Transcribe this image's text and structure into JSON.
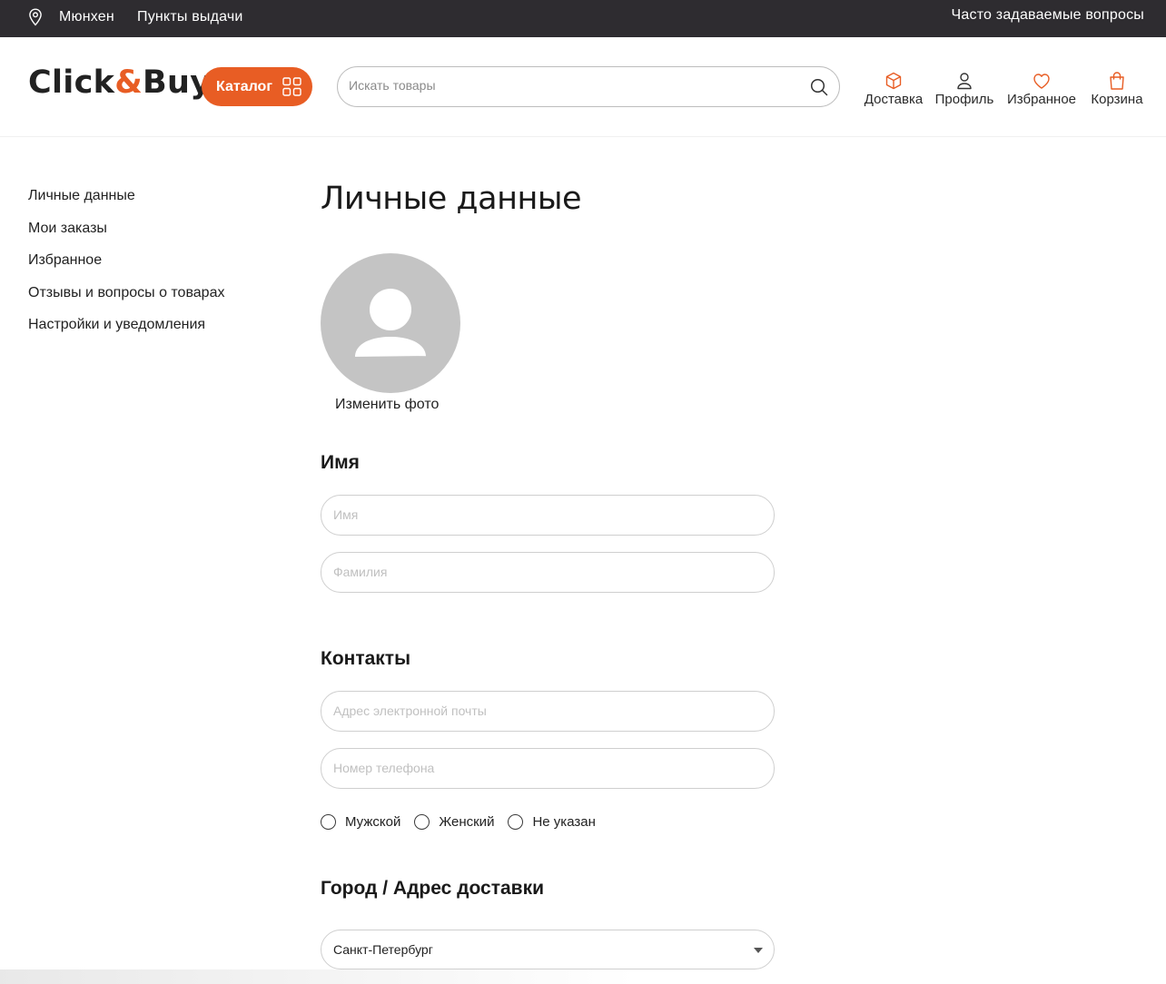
{
  "topbar": {
    "city": "Мюнхен",
    "pickup_points": "Пункты выдачи",
    "faq": "Часто задаваемые вопросы"
  },
  "header": {
    "logo_left": "Click",
    "logo_amp": "&",
    "logo_right": "Buy",
    "catalog_label": "Каталог",
    "search_placeholder": "Искать товары",
    "nav": {
      "delivery": "Доставка",
      "profile": "Профиль",
      "favorites": "Избранное",
      "cart": "Корзина"
    }
  },
  "sidebar": {
    "items": [
      {
        "label": "Личные данные"
      },
      {
        "label": "Мои заказы"
      },
      {
        "label": "Избранное"
      },
      {
        "label": "Отзывы и вопросы о товарах"
      },
      {
        "label": "Настройки и уведомления"
      }
    ]
  },
  "main": {
    "title": "Личные данные",
    "change_photo": "Изменить фото",
    "name_section": {
      "title": "Имя",
      "first_name_placeholder": "Имя",
      "first_name_value": "",
      "last_name_placeholder": "Фамилия",
      "last_name_value": ""
    },
    "contacts_section": {
      "title": "Контакты",
      "email_placeholder": "Адрес электронной почты",
      "email_value": "",
      "phone_placeholder": "Номер телефона",
      "phone_value": ""
    },
    "gender_options": [
      {
        "label": "Мужской",
        "selected": false
      },
      {
        "label": "Женский",
        "selected": false
      },
      {
        "label": "Не указан",
        "selected": false
      }
    ],
    "address_section": {
      "title": "Город / Адрес доставки",
      "city_selected": "Санкт-Петербург"
    }
  },
  "colors": {
    "accent": "#e85d24",
    "topbar_bg": "#2e2c30",
    "avatar_bg": "#c4c4c4"
  },
  "icons": {
    "location": "location-pin-icon",
    "catalog": "grid-icon",
    "search": "search-icon",
    "delivery": "box-icon",
    "profile": "user-icon",
    "favorites": "heart-icon",
    "cart": "shopping-bag-icon",
    "avatar": "user-silhouette-icon",
    "select": "caret-down-icon"
  }
}
